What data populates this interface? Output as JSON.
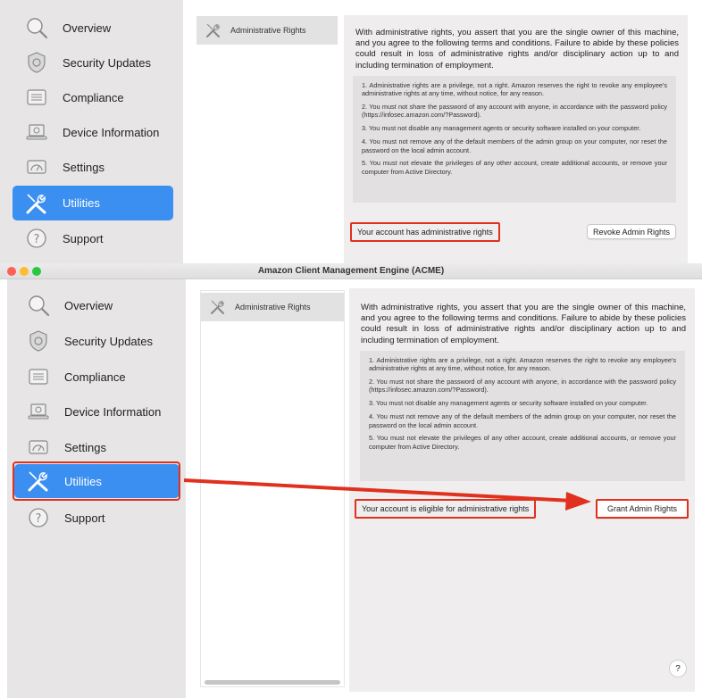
{
  "window": {
    "title": "Amazon Client Management Engine (ACME)"
  },
  "sidebar": {
    "items": [
      {
        "label": "Overview",
        "icon": "magnifier-icon"
      },
      {
        "label": "Security Updates",
        "icon": "shield-icon"
      },
      {
        "label": "Compliance",
        "icon": "checklist-icon"
      },
      {
        "label": "Device Information",
        "icon": "laptop-icon"
      },
      {
        "label": "Settings",
        "icon": "gauge-icon"
      },
      {
        "label": "Utilities",
        "icon": "tools-icon"
      },
      {
        "label": "Support",
        "icon": "help-icon"
      }
    ],
    "active_index": 5
  },
  "list": {
    "header": "Administrative Rights",
    "header_icon": "tools-icon"
  },
  "intro": "With administrative rights, you assert that you are the single owner of this machine, and you agree to the following terms and conditions. Failure to abide by these policies could result in loss of administrative rights and/or disciplinary action up to and including termination of employment.",
  "terms": [
    "1. Administrative rights are a privilege, not a right. Amazon reserves the right to revoke any employee's administrative rights at any time, without notice, for any reason.",
    "2. You must not share the password of any account with anyone, in accordance with the password policy (https://infosec.amazon.com/?Password).",
    "3. You must not disable any management agents or security software installed on your computer.",
    "4. You must not remove any of the default members of the admin group on your computer, nor reset the password on the local admin account.",
    "5. You must not elevate the privileges of any other account, create additional accounts, or remove your computer from Active Directory."
  ],
  "top": {
    "status": "Your account has administrative rights",
    "button": "Revoke Admin Rights"
  },
  "bottom": {
    "status": "Your account is eligible for administrative rights",
    "button": "Grant Admin Rights",
    "help": "?"
  },
  "colors": {
    "accent": "#3b8ff0",
    "highlight": "#e0301e",
    "sidebar_bg": "#e7e5e5",
    "detail_bg": "#efeded",
    "traffic_close": "#ff5f57",
    "traffic_min": "#febc2e",
    "traffic_max": "#28c840"
  }
}
